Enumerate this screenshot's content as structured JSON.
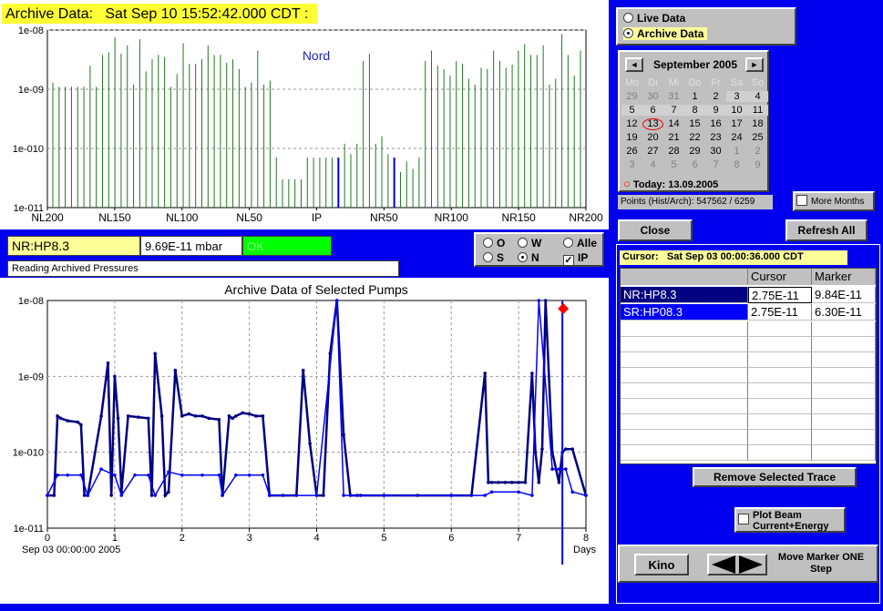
{
  "header": {
    "title": "Archive Data:   Sat Sep 10 15:52:42.000 CDT :"
  },
  "top_chart": {
    "label": "Nord",
    "y_ticks": [
      "1e-08",
      "1e-09",
      "1e-010",
      "1e-011"
    ],
    "x_ticks": [
      "NL200",
      "NL150",
      "NL100",
      "NL50",
      "IP",
      "NR50",
      "NR100",
      "NR150",
      "NR200"
    ]
  },
  "status": {
    "pump": "NR:HP8.3",
    "pressure": "9.69E-11 mbar",
    "state": "OK",
    "message": "Reading Archived Pressures"
  },
  "filter": {
    "o": "O",
    "w": "W",
    "alle": "Alle",
    "s": "S",
    "n": "N",
    "ip": "IP",
    "check": "✓"
  },
  "bottom_chart": {
    "title": "Archive Data of Selected Pumps",
    "y_ticks": [
      "1e-08",
      "1e-09",
      "1e-010",
      "1e-011"
    ],
    "x_ticks": [
      "0",
      "1",
      "2",
      "3",
      "4",
      "5",
      "6",
      "7",
      "8"
    ],
    "x_start": "Sep 03 00:00:00 2005",
    "x_unit": "Days"
  },
  "mode": {
    "live": "Live Data",
    "archive": "Archive Data"
  },
  "calendar": {
    "month": "September 2005",
    "prev": "◄",
    "next": "►",
    "weekdays": [
      "Mo",
      "Di",
      "Mi",
      "Do",
      "Fr",
      "Sa",
      "So"
    ],
    "today": "Today: 13.09.2005",
    "weeks": [
      [
        "29",
        "30",
        "31",
        "1",
        "2",
        "3",
        "4"
      ],
      [
        "5",
        "6",
        "7",
        "8",
        "9",
        "10",
        "11"
      ],
      [
        "12",
        "13",
        "14",
        "15",
        "16",
        "17",
        "18"
      ],
      [
        "19",
        "20",
        "21",
        "22",
        "23",
        "24",
        "25"
      ],
      [
        "26",
        "27",
        "28",
        "29",
        "30",
        "1",
        "2"
      ],
      [
        "3",
        "4",
        "5",
        "6",
        "7",
        "8",
        "9"
      ]
    ]
  },
  "points": "Points (Hist/Arch): 547562 / 6259",
  "more_months": "More Months",
  "buttons": {
    "close": "Close",
    "refresh": "Refresh All",
    "remove": "Remove Selected Trace",
    "kino": "Kino",
    "move_marker": "Move Marker ONE Step"
  },
  "cursor_label": "Cursor:   Sat Sep 03 00:00:36.000 CDT",
  "table": {
    "headers": [
      "",
      "Cursor",
      "Marker"
    ],
    "rows": [
      {
        "name": "NR:HP8.3",
        "cursor": "2.75E-11",
        "marker": "9.84E-11"
      },
      {
        "name": "SR:HP08.3",
        "cursor": "2.75E-11",
        "marker": "6.30E-11"
      }
    ]
  },
  "beam": {
    "label": "Plot Beam Current+Energy"
  },
  "chart_data": [
    {
      "type": "bar",
      "title": "",
      "label": "Nord",
      "ylog": true,
      "ylim": [
        1e-11,
        1e-08
      ],
      "x_ticks": [
        "NL200",
        "NL150",
        "NL100",
        "NL50",
        "IP",
        "NR50",
        "NR100",
        "NR150",
        "NR200"
      ],
      "values": [
        1.3e-09,
        1.1e-09,
        1.1e-09,
        1.1e-09,
        1.1e-09,
        1.1e-09,
        2.5e-09,
        1.1e-09,
        3.8e-09,
        4.2e-09,
        7.5e-09,
        4e-09,
        5.5e-09,
        1.2e-09,
        7e-09,
        2e-09,
        3.2e-09,
        3.8e-09,
        3.5e-09,
        1.1e-09,
        1.8e-09,
        6e-09,
        2.7e-09,
        2.7e-09,
        3.2e-09,
        5.5e-09,
        3.8e-09,
        3.8e-09,
        2.8e-09,
        3.2e-09,
        2.2e-09,
        1.1e-09,
        1.3e-09,
        4.5e-09,
        1.2e-09,
        1.4e-09,
        7e-11,
        3e-11,
        3e-11,
        3e-11,
        3e-11,
        7e-11,
        7e-11,
        7e-11,
        7e-11,
        7e-11,
        7e-11,
        1.2e-10,
        8e-11,
        1.2e-10,
        3e-09,
        4e-09,
        1.2e-10,
        1.6e-10,
        8e-11,
        7e-11,
        4e-11,
        6e-11,
        4.5e-11,
        7e-11,
        3e-09,
        4.5e-09,
        2.5e-09,
        2.2e-09,
        1.7e-09,
        3e-09,
        2.7e-09,
        1.5e-09,
        1.2e-09,
        2.3e-09,
        2.2e-09,
        4.5e-09,
        3e-09,
        2.3e-09,
        2.6e-09,
        4.5e-09,
        5.8e-09,
        3.8e-09,
        3.8e-09,
        5.5e-09,
        1.2e-09,
        1.5e-09,
        8.5e-09,
        3.8e-09,
        1.7e-09,
        4.5e-09
      ]
    },
    {
      "type": "line",
      "title": "Archive Data of Selected Pumps",
      "ylog": true,
      "ylim": [
        1e-11,
        1e-08
      ],
      "xlim": [
        0,
        8
      ],
      "xlabel": "Days",
      "series": [
        {
          "name": "NR:HP8.3",
          "color": "#000080",
          "x": [
            0,
            0.1,
            0.15,
            0.2,
            0.3,
            0.45,
            0.5,
            0.55,
            0.6,
            0.8,
            0.9,
            0.95,
            1.0,
            1.05,
            1.1,
            1.2,
            1.35,
            1.5,
            1.55,
            1.6,
            1.7,
            1.75,
            1.8,
            1.9,
            2.0,
            2.1,
            2.2,
            2.3,
            2.4,
            2.55,
            2.6,
            2.7,
            2.75,
            2.8,
            2.9,
            3.0,
            3.1,
            3.2,
            3.3,
            3.5,
            3.7,
            3.8,
            3.9,
            4.0,
            4.1,
            4.2,
            4.3,
            4.4,
            4.5,
            4.6,
            4.65,
            5.0,
            5.5,
            6.0,
            6.3,
            6.5,
            6.55,
            6.6,
            6.7,
            6.8,
            6.9,
            7.0,
            7.1,
            7.2,
            7.25,
            7.3,
            7.35,
            7.4,
            7.5,
            7.6,
            7.65,
            7.7,
            7.8,
            8.0
          ],
          "y": [
            2.7e-11,
            2.7e-11,
            3e-10,
            2.8e-10,
            2.6e-10,
            2.5e-10,
            2.3e-10,
            2.7e-11,
            2.7e-11,
            3e-10,
            1.5e-09,
            2.7e-11,
            1e-09,
            2.8e-10,
            3e-11,
            3e-10,
            2.9e-10,
            2.8e-10,
            2.7e-11,
            2e-09,
            3e-10,
            2.7e-11,
            3e-11,
            1.2e-09,
            3e-10,
            3.2e-10,
            3e-10,
            3e-10,
            2.8e-10,
            2.7e-10,
            2.7e-11,
            3e-10,
            2.8e-10,
            3e-10,
            3.3e-10,
            3.2e-10,
            3e-10,
            3e-10,
            2.7e-11,
            2.7e-11,
            2.7e-11,
            1.2e-09,
            1.3e-10,
            2.7e-11,
            2.7e-11,
            2e-09,
            1e-08,
            1.7e-10,
            2.7e-11,
            2.7e-11,
            2.7e-11,
            2.7e-11,
            2.7e-11,
            2.7e-11,
            2.7e-11,
            1.1e-09,
            4e-11,
            4e-11,
            4e-11,
            4e-11,
            4e-11,
            4e-11,
            4e-11,
            1.1e-09,
            1e-10,
            4e-11,
            1.1e-10,
            1e-08,
            1e-10,
            4e-11,
            1e-10,
            1.1e-10,
            1.1e-10,
            2.7e-11
          ]
        },
        {
          "name": "SR:HP08.3",
          "color": "#0000ff",
          "x": [
            0,
            0.15,
            0.3,
            0.5,
            0.6,
            0.8,
            1.0,
            1.1,
            1.3,
            1.5,
            1.6,
            1.8,
            2.0,
            2.3,
            2.55,
            2.6,
            2.8,
            3.0,
            3.2,
            3.3,
            4.0,
            4.3,
            4.4,
            5.0,
            6.0,
            6.5,
            6.6,
            7.0,
            7.2,
            7.3,
            7.5,
            7.6,
            7.7,
            7.8,
            8.0
          ],
          "y": [
            2.7e-11,
            5e-11,
            5e-11,
            5e-11,
            2.7e-11,
            6e-11,
            5e-11,
            2.7e-11,
            5e-11,
            5e-11,
            2.7e-11,
            5.5e-11,
            5e-11,
            5e-11,
            5e-11,
            2.7e-11,
            5e-11,
            5e-11,
            5e-11,
            2.7e-11,
            2.7e-11,
            1e-08,
            2.7e-11,
            2.7e-11,
            2.7e-11,
            2.7e-11,
            3e-11,
            3e-11,
            2.7e-11,
            1e-08,
            6e-11,
            6e-11,
            6e-11,
            3e-11,
            2.7e-11
          ]
        }
      ]
    }
  ]
}
